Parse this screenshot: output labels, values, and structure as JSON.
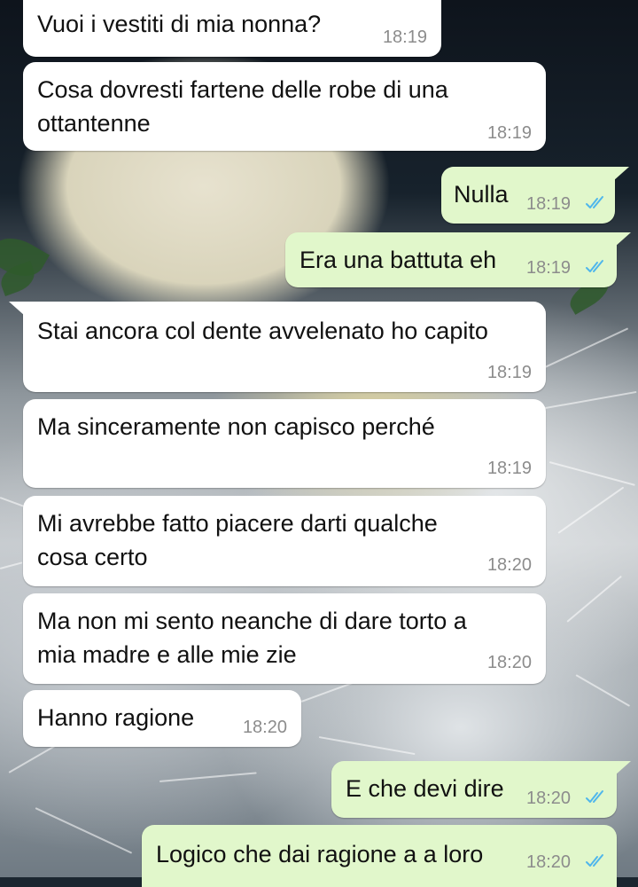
{
  "messages": [
    {
      "id": 0,
      "direction": "incoming",
      "lines": [
        "Vuoi i vestiti di mia nonna?"
      ],
      "time": "18:19"
    },
    {
      "id": 1,
      "direction": "incoming",
      "lines": [
        "Cosa dovresti fartene delle robe di una",
        "ottantenne"
      ],
      "time": "18:19"
    },
    {
      "id": 2,
      "direction": "outgoing",
      "lines": [
        "Nulla"
      ],
      "time": "18:19",
      "status": "read"
    },
    {
      "id": 3,
      "direction": "outgoing",
      "lines": [
        "Era una battuta eh"
      ],
      "time": "18:19",
      "status": "read"
    },
    {
      "id": 4,
      "direction": "incoming",
      "lines": [
        "Stai ancora col dente avvelenato ho capito"
      ],
      "time": "18:19"
    },
    {
      "id": 5,
      "direction": "incoming",
      "lines": [
        "Ma sinceramente non capisco perché"
      ],
      "time": "18:19"
    },
    {
      "id": 6,
      "direction": "incoming",
      "lines": [
        "Mi avrebbe fatto piacere darti qualche",
        "cosa certo"
      ],
      "time": "18:20"
    },
    {
      "id": 7,
      "direction": "incoming",
      "lines": [
        "Ma non mi sento neanche di dare torto a",
        "mia madre e alle mie zie"
      ],
      "time": "18:20"
    },
    {
      "id": 8,
      "direction": "incoming",
      "lines": [
        "Hanno ragione"
      ],
      "time": "18:20"
    },
    {
      "id": 9,
      "direction": "outgoing",
      "lines": [
        "E che devi dire"
      ],
      "time": "18:20",
      "status": "read"
    },
    {
      "id": 10,
      "direction": "outgoing",
      "lines": [
        "Logico che dai ragione a a loro"
      ],
      "time": "18:20",
      "status": "read"
    }
  ],
  "colors": {
    "incoming_bubble": "#ffffff",
    "outgoing_bubble": "#e1f7cb",
    "read_ticks": "#4fb6ec",
    "time_text": "#8c8c8c"
  },
  "icons": {
    "read_status": "double-check-icon"
  }
}
